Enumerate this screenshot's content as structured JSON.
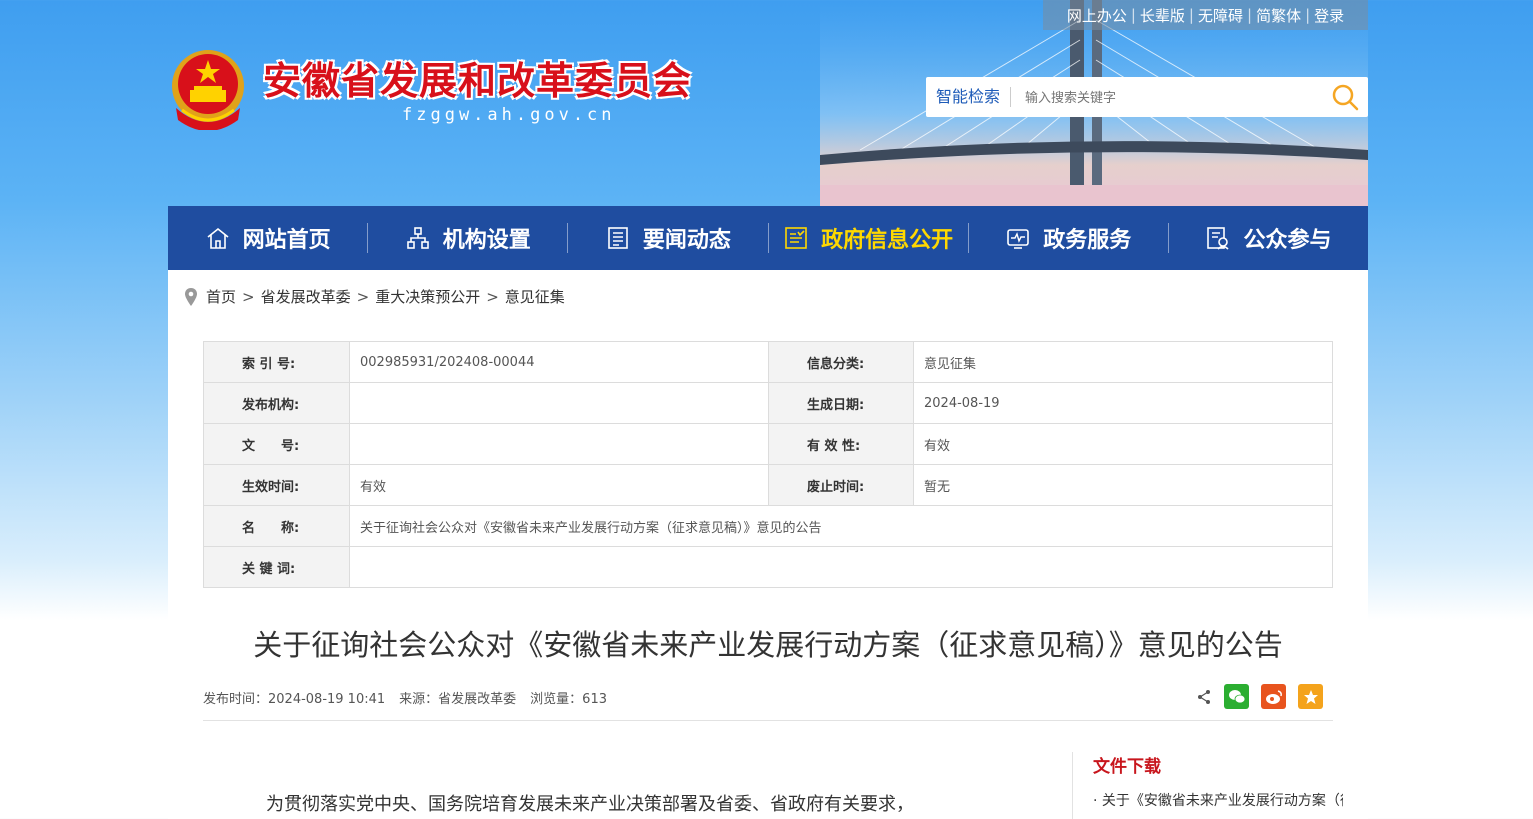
{
  "header": {
    "site_title": "安徽省发展和改革委员会",
    "site_domain": "fzggw.ah.gov.cn",
    "top_links": [
      "网上办公",
      "长辈版",
      "无障碍",
      "简繁体",
      "登录"
    ],
    "search_label": "智能检索",
    "search_placeholder": "输入搜索关键字"
  },
  "nav": {
    "items": [
      {
        "label": "网站首页",
        "icon": "home-icon"
      },
      {
        "label": "机构设置",
        "icon": "org-icon"
      },
      {
        "label": "要闻动态",
        "icon": "news-icon"
      },
      {
        "label": "政府信息公开",
        "icon": "info-icon",
        "active": true
      },
      {
        "label": "政务服务",
        "icon": "service-icon"
      },
      {
        "label": "公众参与",
        "icon": "participation-icon"
      }
    ],
    "active_color": "#ffd800",
    "bg_color": "#1f4da0"
  },
  "breadcrumb": [
    "首页",
    "省发展改革委",
    "重大决策预公开",
    "意见征集"
  ],
  "meta": {
    "index_label": "索 引 号:",
    "index_value": "002985931/202408-00044",
    "category_label": "信息分类:",
    "category_value": "意见征集",
    "publisher_label": "发布机构:",
    "publisher_value": "",
    "date_label": "生成日期:",
    "date_value": "2024-08-19",
    "docno_label": "文　　号:",
    "docno_value": "",
    "validity_label": "有 效 性:",
    "validity_value": "有效",
    "effective_label": "生效时间:",
    "effective_value": "有效",
    "expire_label": "废止时间:",
    "expire_value": "暂无",
    "name_label": "名　　称:",
    "name_value": "关于征询社会公众对《安徽省未来产业发展行动方案（征求意见稿）》意见的公告",
    "keywords_label": "关 键 词:",
    "keywords_value": ""
  },
  "article": {
    "title": "关于征询社会公众对《安徽省未来产业发展行动方案（征求意见稿）》意见的公告",
    "publish_time": "发布时间：2024-08-19 10:41",
    "source": "来源：省发展改革委",
    "views": "浏览量：613",
    "body_first_line": "为贯彻落实党中央、国务院培育发展未来产业决策部署及省委、省政府有关要求，"
  },
  "sidebar": {
    "heading": "文件下载",
    "file": "· 关于《安徽省未来产业发展行动方案（征求意见稿）》的说"
  }
}
